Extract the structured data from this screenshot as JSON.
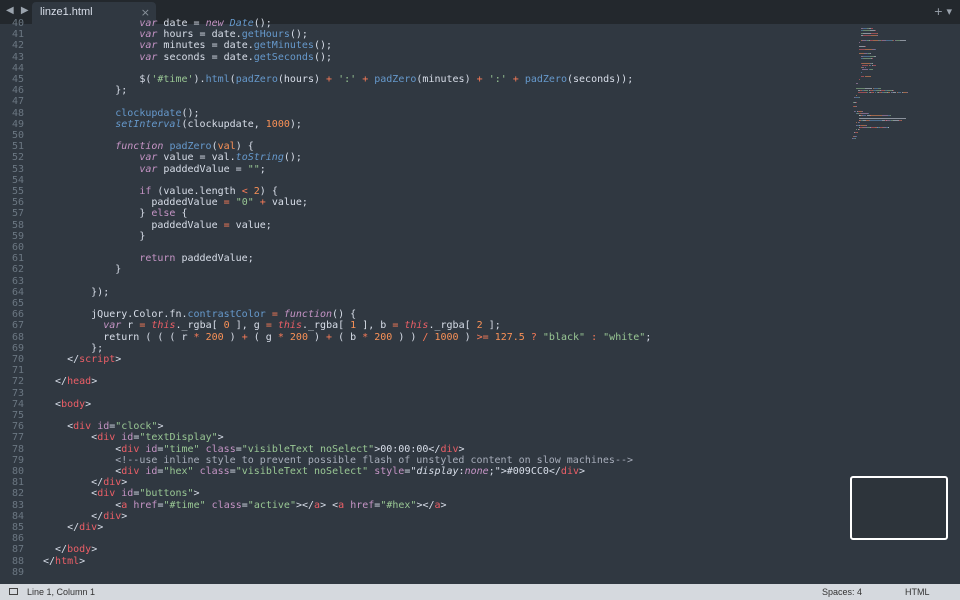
{
  "tabbar": {
    "nav_icon": "arrow-left-right-icon",
    "tab_title": "linze1.html",
    "close_glyph": "×",
    "actions_glyph": "+ ▾"
  },
  "editor": {
    "line_numbers": [
      "40",
      "41",
      "42",
      "43",
      "44",
      "45",
      "46",
      "47",
      "48",
      "49",
      "50",
      "51",
      "52",
      "53",
      "54",
      "55",
      "56",
      "57",
      "58",
      "59",
      "60",
      "61",
      "62",
      "63",
      "64",
      "65",
      "66",
      "67",
      "68",
      "69",
      "70",
      "71",
      "72",
      "73",
      "74",
      "75",
      "76",
      "77",
      "78",
      "79",
      "80",
      "81",
      "82",
      "83",
      "84",
      "85",
      "86",
      "87",
      "88",
      "89"
    ],
    "lines": [
      [
        {
          "t": "                var ",
          "c": "kw"
        },
        {
          "t": "date = "
        },
        {
          "t": "new ",
          "c": "kw"
        },
        {
          "t": "Date",
          "c": "fi"
        },
        {
          "t": "();"
        }
      ],
      [
        {
          "t": "                var ",
          "c": "kw"
        },
        {
          "t": "hours = date."
        },
        {
          "t": "getHours",
          "c": "fn"
        },
        {
          "t": "();"
        }
      ],
      [
        {
          "t": "                var ",
          "c": "kw"
        },
        {
          "t": "minutes = date."
        },
        {
          "t": "getMinutes",
          "c": "fn"
        },
        {
          "t": "();"
        }
      ],
      [
        {
          "t": "                var ",
          "c": "kw"
        },
        {
          "t": "seconds = date."
        },
        {
          "t": "getSeconds",
          "c": "fn"
        },
        {
          "t": "();"
        }
      ],
      [
        {
          "t": ""
        }
      ],
      [
        {
          "t": "                $("
        },
        {
          "t": "'#time'",
          "c": "str"
        },
        {
          "t": ")."
        },
        {
          "t": "html",
          "c": "fn"
        },
        {
          "t": "("
        },
        {
          "t": "padZero",
          "c": "fn"
        },
        {
          "t": "(hours) "
        },
        {
          "t": "+",
          "c": "op"
        },
        {
          "t": " "
        },
        {
          "t": "':'",
          "c": "str"
        },
        {
          "t": " "
        },
        {
          "t": "+",
          "c": "op"
        },
        {
          "t": " "
        },
        {
          "t": "padZero",
          "c": "fn"
        },
        {
          "t": "(minutes) "
        },
        {
          "t": "+",
          "c": "op"
        },
        {
          "t": " "
        },
        {
          "t": "':'",
          "c": "str"
        },
        {
          "t": " "
        },
        {
          "t": "+",
          "c": "op"
        },
        {
          "t": " "
        },
        {
          "t": "padZero",
          "c": "fn"
        },
        {
          "t": "(seconds));"
        }
      ],
      [
        {
          "t": "            };"
        }
      ],
      [
        {
          "t": ""
        }
      ],
      [
        {
          "t": "            "
        },
        {
          "t": "clockupdate",
          "c": "fn"
        },
        {
          "t": "();"
        }
      ],
      [
        {
          "t": "            "
        },
        {
          "t": "setInterval",
          "c": "fi"
        },
        {
          "t": "(clockupdate, "
        },
        {
          "t": "1000",
          "c": "num"
        },
        {
          "t": ");"
        }
      ],
      [
        {
          "t": ""
        }
      ],
      [
        {
          "t": "            function ",
          "c": "kw"
        },
        {
          "t": "padZero",
          "c": "fn"
        },
        {
          "t": "("
        },
        {
          "t": "val",
          "c": "num"
        },
        {
          "t": ") {"
        }
      ],
      [
        {
          "t": "                var ",
          "c": "kw"
        },
        {
          "t": "value = val."
        },
        {
          "t": "toString",
          "c": "fi"
        },
        {
          "t": "();"
        }
      ],
      [
        {
          "t": "                var ",
          "c": "kw"
        },
        {
          "t": "paddedValue = "
        },
        {
          "t": "\"\"",
          "c": "str"
        },
        {
          "t": ";"
        }
      ],
      [
        {
          "t": ""
        }
      ],
      [
        {
          "t": "                "
        },
        {
          "t": "if",
          "c": "attr"
        },
        {
          "t": " (value.length "
        },
        {
          "t": "<",
          "c": "op"
        },
        {
          "t": " "
        },
        {
          "t": "2",
          "c": "num"
        },
        {
          "t": ") {"
        }
      ],
      [
        {
          "t": "                  paddedValue "
        },
        {
          "t": "=",
          "c": "op"
        },
        {
          "t": " "
        },
        {
          "t": "\"0\"",
          "c": "str"
        },
        {
          "t": " "
        },
        {
          "t": "+",
          "c": "op"
        },
        {
          "t": " value;"
        }
      ],
      [
        {
          "t": "                } "
        },
        {
          "t": "else",
          "c": "attr"
        },
        {
          "t": " {"
        }
      ],
      [
        {
          "t": "                  paddedValue "
        },
        {
          "t": "=",
          "c": "op"
        },
        {
          "t": " value;"
        }
      ],
      [
        {
          "t": "                }"
        }
      ],
      [
        {
          "t": ""
        }
      ],
      [
        {
          "t": "                "
        },
        {
          "t": "return",
          "c": "attr"
        },
        {
          "t": " paddedValue;"
        }
      ],
      [
        {
          "t": "            }"
        }
      ],
      [
        {
          "t": ""
        }
      ],
      [
        {
          "t": "        });"
        }
      ],
      [
        {
          "t": ""
        }
      ],
      [
        {
          "t": "        jQuery.Color.fn."
        },
        {
          "t": "contrastColor",
          "c": "fn"
        },
        {
          "t": " "
        },
        {
          "t": "=",
          "c": "op"
        },
        {
          "t": " "
        },
        {
          "t": "function",
          "c": "kw"
        },
        {
          "t": "() {"
        }
      ],
      [
        {
          "t": "          var ",
          "c": "kw"
        },
        {
          "t": "r "
        },
        {
          "t": "=",
          "c": "op"
        },
        {
          "t": " "
        },
        {
          "t": "this",
          "c": "th"
        },
        {
          "t": "._rgba[ "
        },
        {
          "t": "0",
          "c": "num"
        },
        {
          "t": " ], g "
        },
        {
          "t": "=",
          "c": "op"
        },
        {
          "t": " "
        },
        {
          "t": "this",
          "c": "th"
        },
        {
          "t": "._rgba[ "
        },
        {
          "t": "1",
          "c": "num"
        },
        {
          "t": " ], b "
        },
        {
          "t": "=",
          "c": "op"
        },
        {
          "t": " "
        },
        {
          "t": "this",
          "c": "th"
        },
        {
          "t": "._rgba[ "
        },
        {
          "t": "2",
          "c": "num"
        },
        {
          "t": " ];"
        }
      ],
      [
        {
          "t": "          return ( ( ( r "
        },
        {
          "t": "*",
          "c": "op"
        },
        {
          "t": " "
        },
        {
          "t": "200",
          "c": "num"
        },
        {
          "t": " ) "
        },
        {
          "t": "+",
          "c": "op"
        },
        {
          "t": " ( g "
        },
        {
          "t": "*",
          "c": "op"
        },
        {
          "t": " "
        },
        {
          "t": "200",
          "c": "num"
        },
        {
          "t": " ) "
        },
        {
          "t": "+",
          "c": "op"
        },
        {
          "t": " ( b "
        },
        {
          "t": "*",
          "c": "op"
        },
        {
          "t": " "
        },
        {
          "t": "200",
          "c": "num"
        },
        {
          "t": " ) ) "
        },
        {
          "t": "/",
          "c": "op"
        },
        {
          "t": " "
        },
        {
          "t": "1000",
          "c": "num"
        },
        {
          "t": " ) "
        },
        {
          "t": ">=",
          "c": "op"
        },
        {
          "t": " "
        },
        {
          "t": "127.5",
          "c": "num"
        },
        {
          "t": " "
        },
        {
          "t": "?",
          "c": "op"
        },
        {
          "t": " "
        },
        {
          "t": "\"black\"",
          "c": "str"
        },
        {
          "t": " "
        },
        {
          "t": ":",
          "c": "op"
        },
        {
          "t": " "
        },
        {
          "t": "\"white\"",
          "c": "str"
        },
        {
          "t": ";"
        }
      ],
      [
        {
          "t": "        };"
        }
      ],
      [
        {
          "t": "    </"
        },
        {
          "t": "script",
          "c": "tag"
        },
        {
          "t": ">"
        }
      ],
      [
        {
          "t": ""
        }
      ],
      [
        {
          "t": "  </"
        },
        {
          "t": "head",
          "c": "tag"
        },
        {
          "t": ">"
        }
      ],
      [
        {
          "t": ""
        }
      ],
      [
        {
          "t": "  <"
        },
        {
          "t": "body",
          "c": "tag"
        },
        {
          "t": ">"
        }
      ],
      [
        {
          "t": ""
        }
      ],
      [
        {
          "t": "    <"
        },
        {
          "t": "div",
          "c": "tag"
        },
        {
          "t": " "
        },
        {
          "t": "id",
          "c": "attr"
        },
        {
          "t": "="
        },
        {
          "t": "\"clock\"",
          "c": "str"
        },
        {
          "t": ">"
        }
      ],
      [
        {
          "t": "        <"
        },
        {
          "t": "div",
          "c": "tag"
        },
        {
          "t": " "
        },
        {
          "t": "id",
          "c": "attr"
        },
        {
          "t": "="
        },
        {
          "t": "\"textDisplay\"",
          "c": "str"
        },
        {
          "t": ">"
        }
      ],
      [
        {
          "t": "            <"
        },
        {
          "t": "div",
          "c": "tag"
        },
        {
          "t": " "
        },
        {
          "t": "id",
          "c": "attr"
        },
        {
          "t": "="
        },
        {
          "t": "\"time\"",
          "c": "str"
        },
        {
          "t": " "
        },
        {
          "t": "class",
          "c": "attr"
        },
        {
          "t": "="
        },
        {
          "t": "\"visibleText noSelect\"",
          "c": "str"
        },
        {
          "t": ">00:00:00</"
        },
        {
          "t": "div",
          "c": "tag"
        },
        {
          "t": ">"
        }
      ],
      [
        {
          "t": "            <!--use inline style to prevent possible flash of unstyled content on slow machines-->",
          "c": "cmt"
        }
      ],
      [
        {
          "t": "            <"
        },
        {
          "t": "div",
          "c": "tag"
        },
        {
          "t": " "
        },
        {
          "t": "id",
          "c": "attr"
        },
        {
          "t": "="
        },
        {
          "t": "\"hex\"",
          "c": "str"
        },
        {
          "t": " "
        },
        {
          "t": "class",
          "c": "attr"
        },
        {
          "t": "="
        },
        {
          "t": "\"visibleText noSelect\"",
          "c": "str"
        },
        {
          "t": " "
        },
        {
          "t": "style",
          "c": "attr"
        },
        {
          "t": "="
        },
        {
          "t": "\""
        },
        {
          "t": "display",
          "c": "it"
        },
        {
          "t": ":"
        },
        {
          "t": "none",
          "c": "kw"
        },
        {
          "t": ";\">#009CC0</"
        },
        {
          "t": "div",
          "c": "tag"
        },
        {
          "t": ">"
        }
      ],
      [
        {
          "t": "        </"
        },
        {
          "t": "div",
          "c": "tag"
        },
        {
          "t": ">"
        }
      ],
      [
        {
          "t": "        <"
        },
        {
          "t": "div",
          "c": "tag"
        },
        {
          "t": " "
        },
        {
          "t": "id",
          "c": "attr"
        },
        {
          "t": "="
        },
        {
          "t": "\"buttons\"",
          "c": "str"
        },
        {
          "t": ">"
        }
      ],
      [
        {
          "t": "            <"
        },
        {
          "t": "a",
          "c": "tag"
        },
        {
          "t": " "
        },
        {
          "t": "href",
          "c": "attr"
        },
        {
          "t": "="
        },
        {
          "t": "\"#time\"",
          "c": "str"
        },
        {
          "t": " "
        },
        {
          "t": "class",
          "c": "attr"
        },
        {
          "t": "="
        },
        {
          "t": "\"active\"",
          "c": "str"
        },
        {
          "t": "></"
        },
        {
          "t": "a",
          "c": "tag"
        },
        {
          "t": "> <"
        },
        {
          "t": "a",
          "c": "tag"
        },
        {
          "t": " "
        },
        {
          "t": "href",
          "c": "attr"
        },
        {
          "t": "="
        },
        {
          "t": "\"#hex\"",
          "c": "str"
        },
        {
          "t": "></"
        },
        {
          "t": "a",
          "c": "tag"
        },
        {
          "t": ">"
        }
      ],
      [
        {
          "t": "        </"
        },
        {
          "t": "div",
          "c": "tag"
        },
        {
          "t": ">"
        }
      ],
      [
        {
          "t": "    </"
        },
        {
          "t": "div",
          "c": "tag"
        },
        {
          "t": ">"
        }
      ],
      [
        {
          "t": ""
        }
      ],
      [
        {
          "t": "  </"
        },
        {
          "t": "body",
          "c": "tag"
        },
        {
          "t": ">"
        }
      ],
      [
        {
          "t": "</"
        },
        {
          "t": "html",
          "c": "tag"
        },
        {
          "t": ">"
        }
      ],
      [
        {
          "t": ""
        }
      ]
    ]
  },
  "statusbar": {
    "panel_icon": "panel-toggle-icon",
    "position": "Line 1, Column 1",
    "spaces": "Spaces: 4",
    "syntax": "HTML"
  }
}
